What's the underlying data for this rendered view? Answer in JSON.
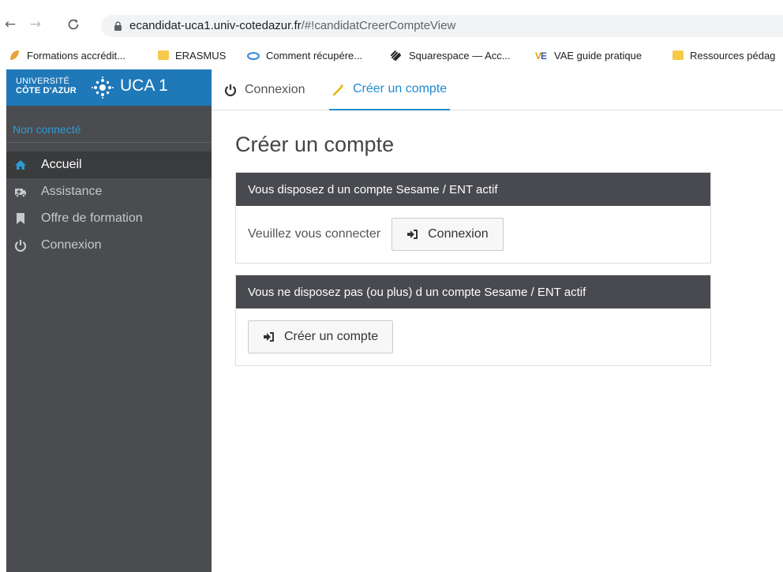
{
  "browser": {
    "url_host": "ecandidat-uca1.univ-cotedazur.fr",
    "url_path": "/#!candidatCreerCompteView",
    "bookmarks": [
      {
        "label": "Formations accrédit...",
        "icon": "leaf-icon"
      },
      {
        "label": "ERASMUS",
        "icon": "folder-icon"
      },
      {
        "label": "Comment récupére...",
        "icon": "cloud-icon"
      },
      {
        "label": "Squarespace — Acc...",
        "icon": "squarespace-icon"
      },
      {
        "label": "VAE guide pratique",
        "icon": "vae-icon"
      },
      {
        "label": "Ressources pédag",
        "icon": "folder-icon"
      }
    ]
  },
  "brand": {
    "uni_line1": "UNIVERSITÉ",
    "uni_line2": "CÔTE D'AZUR",
    "app_name": "UCA 1"
  },
  "sidebar": {
    "status": "Non connecté",
    "items": [
      {
        "label": "Accueil",
        "icon": "home-icon",
        "active": true
      },
      {
        "label": "Assistance",
        "icon": "ambulance-icon",
        "active": false
      },
      {
        "label": "Offre de formation",
        "icon": "bookmark-icon",
        "active": false
      },
      {
        "label": "Connexion",
        "icon": "power-icon",
        "active": false
      }
    ]
  },
  "tabs": [
    {
      "label": "Connexion",
      "icon": "power-icon"
    },
    {
      "label": "Créer un compte",
      "icon": "magic-wand-icon"
    }
  ],
  "main": {
    "title": "Créer un compte",
    "panel1": {
      "header": "Vous disposez d un compte Sesame / ENT actif",
      "text": "Veuillez vous connecter",
      "button": "Connexion"
    },
    "panel2": {
      "header": "Vous ne disposez pas (ou plus) d un compte Sesame / ENT actif",
      "button": "Créer un compte"
    }
  },
  "colors": {
    "accent": "#1f8bd0",
    "brand": "#1f78b8",
    "sidebar": "#4b4c4f",
    "panel_header": "#494a4f"
  }
}
